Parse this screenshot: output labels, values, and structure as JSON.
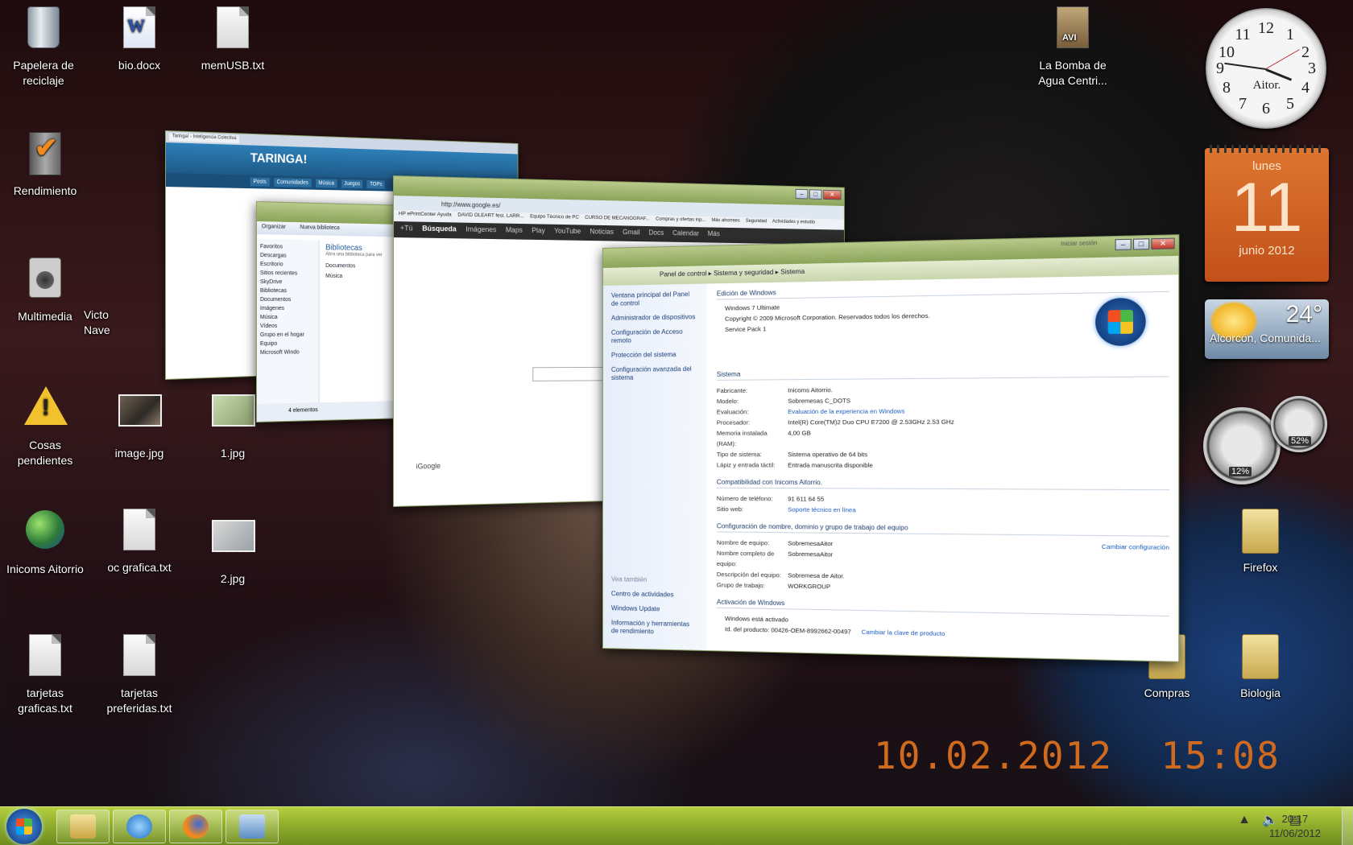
{
  "desktop": {
    "icons": [
      {
        "label": "Papelera de reciclaje",
        "kind": "bin"
      },
      {
        "label": "bio.docx",
        "kind": "word"
      },
      {
        "label": "memUSB.txt",
        "kind": "txt"
      },
      {
        "label": "Rendimiento",
        "kind": "pc"
      },
      {
        "label": "Multimedia",
        "kind": "speaker"
      },
      {
        "label": "Victo Nave",
        "kind": "partial"
      },
      {
        "label": "Cosas pendientes",
        "kind": "warning"
      },
      {
        "label": "image.jpg",
        "kind": "image"
      },
      {
        "label": "1.jpg",
        "kind": "image"
      },
      {
        "label": "Inicoms Aitorrio",
        "kind": "globe"
      },
      {
        "label": "oc grafica.txt",
        "kind": "txt"
      },
      {
        "label": "2.jpg",
        "kind": "image"
      },
      {
        "label": "tarjetas graficas.txt",
        "kind": "txt"
      },
      {
        "label": "tarjetas preferidas.txt",
        "kind": "txt"
      },
      {
        "label": "La Bomba de Agua Centri...",
        "kind": "avi"
      },
      {
        "label": "Firefox",
        "kind": "folder"
      },
      {
        "label": "Compras",
        "kind": "folder"
      },
      {
        "label": "Biologia",
        "kind": "folder"
      }
    ],
    "photo_date_stamp": "10.02.2012  15:08"
  },
  "gadgets": {
    "clock": {
      "brand": "Aitor.",
      "numbers": [
        "12",
        "1",
        "2",
        "3",
        "4",
        "5",
        "6",
        "7",
        "8",
        "9",
        "10",
        "11"
      ]
    },
    "calendar": {
      "day_name": "lunes",
      "day_number": "11",
      "month_year": "junio 2012"
    },
    "weather": {
      "temperature": "24°",
      "location": "Alcorcón, Comunida..."
    },
    "cpu_meter": {
      "cpu": "12%",
      "ram": "52%"
    }
  },
  "windows": {
    "taringa": {
      "title": "Taringa! - Inteligencia Colectiva",
      "brand": "TARINGA!",
      "nav": [
        "Posts",
        "Comunidades",
        "Música",
        "Juegos",
        "TOPs"
      ]
    },
    "libraries": {
      "title": "Bibliotecas",
      "toolbar": [
        "Organizar",
        "Nueva biblioteca"
      ],
      "sidebar": [
        "Favoritos",
        "Descargas",
        "Escritorio",
        "Sitios recientes",
        "SkyDrive",
        "Bibliotecas",
        "Documentos",
        "Imágenes",
        "Música",
        "Vídeos",
        "Grupo en el hogar",
        "Equipo",
        "Microsoft Windo"
      ],
      "heading": "Bibliotecas",
      "subheading": "Abra una biblioteca para ver",
      "items": [
        "Documentos",
        "Música"
      ],
      "status": "4 elementos"
    },
    "google": {
      "address": "http://www.google.es/",
      "favorites": [
        "HP ePrintCenter  Ayuda",
        "DAVID OLEART fest. LARR...",
        "Equipo Técnico de PC",
        "CURSO DE MECANOGRAF...",
        "Compras y ofertas inp...",
        "Más ahorrees",
        "Seguridad",
        "Actividades y estudio"
      ],
      "gbar": [
        "+Tú",
        "Búsqueda",
        "Imágenes",
        "Maps",
        "Play",
        "YouTube",
        "Noticias",
        "Gmail",
        "Docs",
        "Calendar",
        "Más"
      ],
      "footer": "iGoogle"
    },
    "system": {
      "breadcrumb": [
        "Panel de control",
        "Sistema y seguridad",
        "Sistema"
      ],
      "login": "Iniciar sesión",
      "left_links": [
        "Ventana principal del Panel de control",
        "Administrador de dispositivos",
        "Configuración de Acceso remoto",
        "Protección del sistema",
        "Configuración avanzada del sistema"
      ],
      "see_also": "Vea también",
      "see_also_links": [
        "Centro de actividades",
        "Windows Update",
        "Información y herramientas de rendimiento"
      ],
      "edition_header": "Edición de Windows",
      "edition": "Windows 7 Ultimate",
      "copyright": "Copyright © 2009 Microsoft Corporation. Reservados todos los derechos.",
      "service_pack": "Service Pack 1",
      "system_header": "Sistema",
      "system_rows": [
        {
          "k": "Fabricante:",
          "v": "Inicoms Aitorrio."
        },
        {
          "k": "Modelo:",
          "v": "Sobremesas C_DOTS"
        },
        {
          "k": "Evaluación:",
          "v": "Evaluación de la experiencia en Windows"
        },
        {
          "k": "Procesador:",
          "v": "Intel(R) Core(TM)2 Duo CPU    E7200  @ 2.53GHz   2.53 GHz"
        },
        {
          "k": "Memoria instalada (RAM):",
          "v": "4,00 GB"
        },
        {
          "k": "Tipo de sistema:",
          "v": "Sistema operativo de 64 bits"
        },
        {
          "k": "Lápiz y entrada táctil:",
          "v": "Entrada manuscrita disponible"
        }
      ],
      "support_header": "Compatibilidad con Inicoms Aitorrio.",
      "support_rows": [
        {
          "k": "Número de teléfono:",
          "v": "91 611 64 55"
        },
        {
          "k": "Sitio web:",
          "v": "Soporte técnico en línea"
        }
      ],
      "computer_header": "Configuración de nombre, dominio y grupo de trabajo del equipo",
      "computer_rows": [
        {
          "k": "Nombre de equipo:",
          "v": "SobremesaAitor"
        },
        {
          "k": "Nombre completo de equipo:",
          "v": "SobremesaAitor"
        },
        {
          "k": "Descripción del equipo:",
          "v": "Sobremesa de Aitor."
        },
        {
          "k": "Grupo de trabajo:",
          "v": "WORKGROUP"
        }
      ],
      "change_settings": "Cambiar configuración",
      "activation_header": "Activación de Windows",
      "activation_status": "Windows está activado",
      "product_id": "Id. del producto: 00426-OEM-8992662-00497",
      "change_key": "Cambiar la clave de producto"
    }
  },
  "taskbar": {
    "time": "20:17",
    "date": "11/06/2012"
  }
}
